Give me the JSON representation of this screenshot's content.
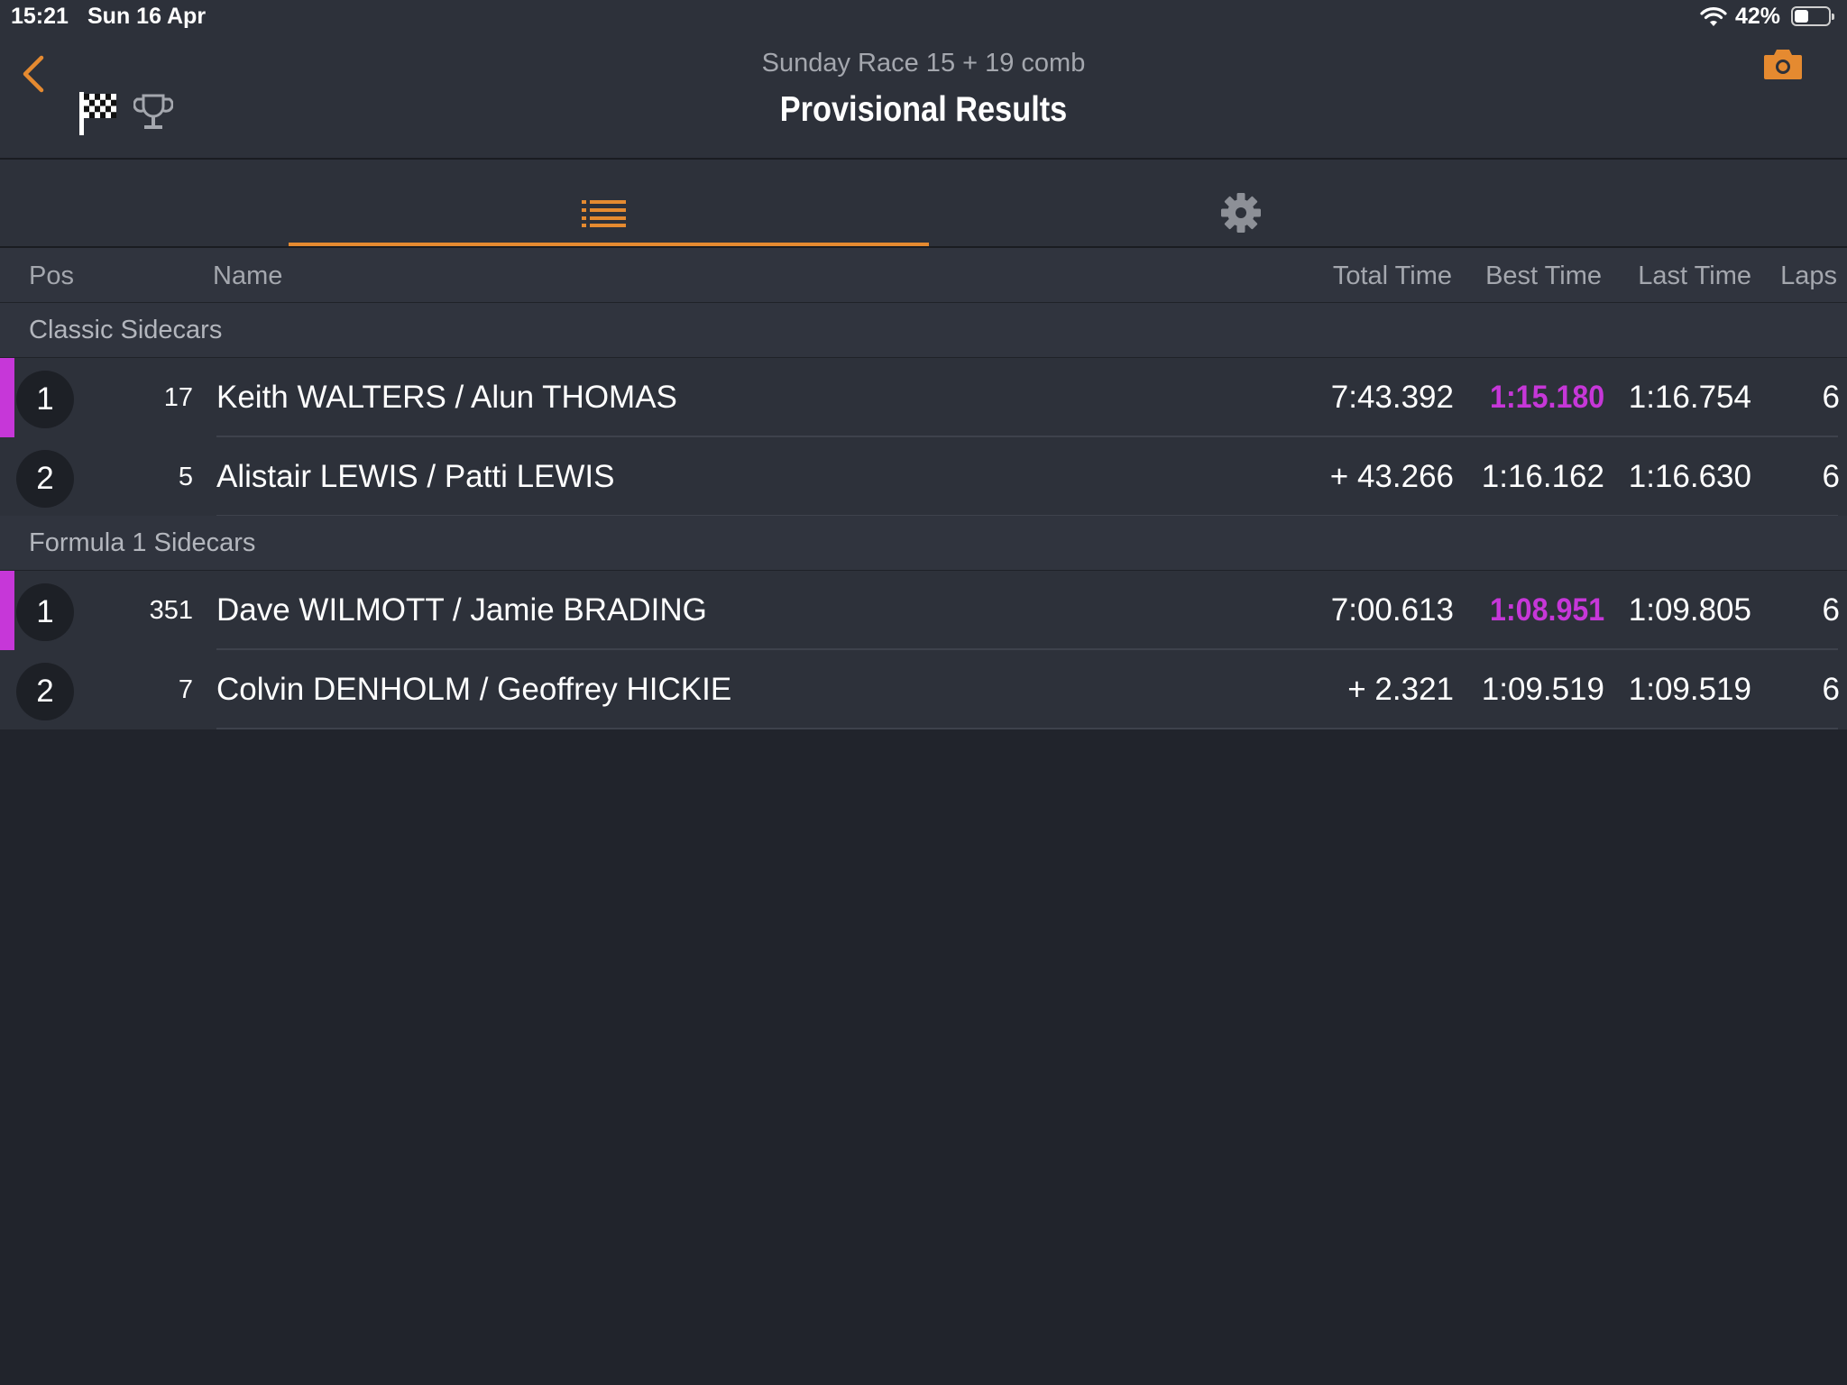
{
  "status_bar": {
    "time": "15:21",
    "date": "Sun 16 Apr",
    "battery_pct": "42%",
    "battery_level": 0.42
  },
  "header": {
    "subtitle": "Sunday Race 15 + 19 comb",
    "title": "Provisional Results"
  },
  "colors": {
    "accent": "#e58a30",
    "fastest": "#c637d8",
    "background": "#21242c",
    "panel": "#2d313a"
  },
  "icons": {
    "back": "chevron-left-icon",
    "flag": "checkered-flag-icon",
    "trophy": "trophy-icon",
    "camera": "camera-icon",
    "list": "list-icon",
    "settings": "gear-icon"
  },
  "columns": {
    "pos": "Pos",
    "name": "Name",
    "total": "Total Time",
    "best": "Best Time",
    "last": "Last Time",
    "laps": "Laps"
  },
  "groups": [
    {
      "label": "Classic Sidecars",
      "rows": [
        {
          "pos": "1",
          "num": "17",
          "name": "Keith WALTERS / Alun THOMAS",
          "total": "7:43.392",
          "best": "1:15.180",
          "last": "1:16.754",
          "laps": "6",
          "leader": true,
          "fastest": true
        },
        {
          "pos": "2",
          "num": "5",
          "name": "Alistair LEWIS / Patti LEWIS",
          "total": "+ 43.266",
          "best": "1:16.162",
          "last": "1:16.630",
          "laps": "6",
          "leader": false,
          "fastest": false
        }
      ]
    },
    {
      "label": "Formula 1 Sidecars",
      "rows": [
        {
          "pos": "1",
          "num": "351",
          "name": "Dave WILMOTT / Jamie BRADING",
          "total": "7:00.613",
          "best": "1:08.951",
          "last": "1:09.805",
          "laps": "6",
          "leader": true,
          "fastest": true
        },
        {
          "pos": "2",
          "num": "7",
          "name": "Colvin DENHOLM / Geoffrey HICKIE",
          "total": "+ 2.321",
          "best": "1:09.519",
          "last": "1:09.519",
          "laps": "6",
          "leader": false,
          "fastest": false
        }
      ]
    }
  ]
}
